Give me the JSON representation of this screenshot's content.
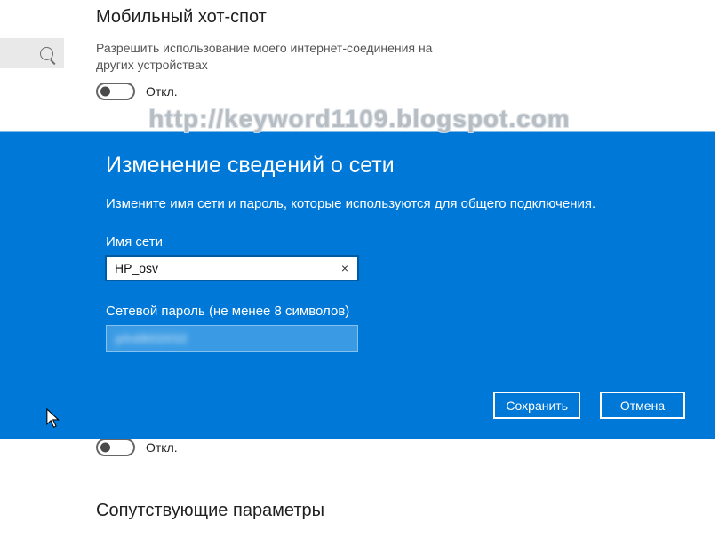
{
  "header": {
    "title": "Мобильный хот-спот",
    "desc": "Разрешить использование моего интернет-соединения на других устройствах",
    "toggle_state": "Откл."
  },
  "watermark": "http://keyword1109.blogspot.com",
  "dialog": {
    "title": "Изменение сведений о сети",
    "desc": "Измените имя сети и пароль, которые используются для общего подключения.",
    "network_label": "Имя сети",
    "network_value": "HP_osv",
    "clear_symbol": "×",
    "password_label": "Сетевой пароль (не менее 8 символов)",
    "password_hidden": "phd802032",
    "save": "Сохранить",
    "cancel": "Отмена"
  },
  "below": {
    "toggle_state": "Откл.",
    "heading": "Сопутствующие параметры"
  }
}
